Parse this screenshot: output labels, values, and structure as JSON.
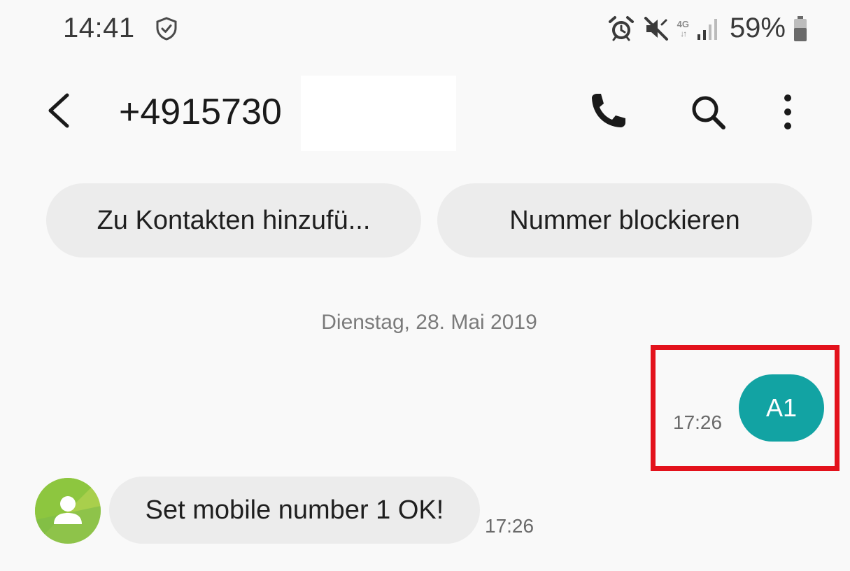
{
  "status_bar": {
    "time": "14:41",
    "network_type": "4G",
    "network_arrows": "↓↑",
    "battery_percent": "59%",
    "icons": [
      "shield-check-icon",
      "alarm-icon",
      "mute-icon",
      "network-4g-icon",
      "signal-icon",
      "battery-icon"
    ]
  },
  "header": {
    "contact_number": "+4915730",
    "icons": [
      "back-icon",
      "phone-icon",
      "search-icon",
      "more-vert-icon"
    ]
  },
  "actions": {
    "add_contact_label": "Zu Kontakten hinzufü...",
    "block_number_label": "Nummer blockieren"
  },
  "conversation": {
    "date_label": "Dienstag, 28. Mai 2019",
    "messages": [
      {
        "direction": "outgoing",
        "text": "A1",
        "time": "17:26"
      },
      {
        "direction": "incoming",
        "text": "Set mobile number 1 OK!",
        "time": "17:26"
      }
    ]
  },
  "colors": {
    "outgoing_bubble": "#12a3a3",
    "incoming_bubble": "#ececec",
    "chip_background": "#ececec",
    "highlight_border": "#e3121c",
    "avatar_green": "#8dc63f"
  }
}
